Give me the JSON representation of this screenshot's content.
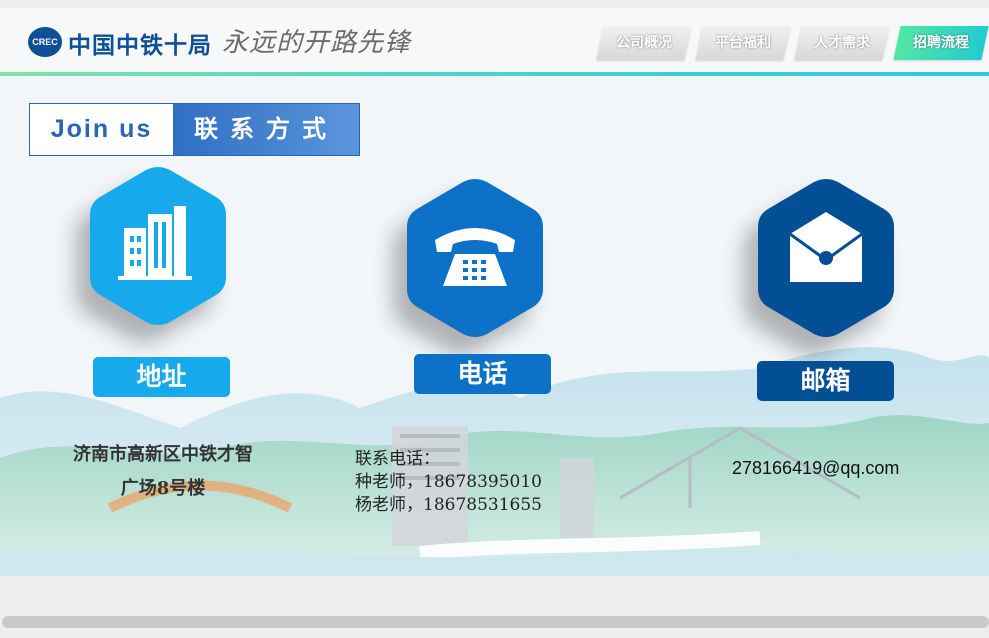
{
  "header": {
    "logo_text": "中国中铁十局",
    "logo_badge": "CREC",
    "slogan": "永远的开路先锋",
    "nav": [
      {
        "label": "公司概况",
        "active": false
      },
      {
        "label": "平台福利",
        "active": false
      },
      {
        "label": "人才需求",
        "active": false
      },
      {
        "label": "招聘流程",
        "active": true
      }
    ]
  },
  "section": {
    "title_en": "Join us",
    "title_zh": "联系方式"
  },
  "contacts": {
    "address": {
      "icon": "building-icon",
      "label": "地址",
      "lines": [
        "济南市高新区中铁才智",
        "广场8号楼"
      ],
      "color": "#16a9ec"
    },
    "phone": {
      "icon": "telephone-icon",
      "label": "电话",
      "lines": [
        "联系电话：",
        "种老师，18678395010",
        "杨老师，18678531655"
      ],
      "color": "#0d72c7"
    },
    "email": {
      "icon": "envelope-icon",
      "label": "邮箱",
      "value": "278166419@qq.com",
      "color": "#034f95"
    }
  },
  "colors": {
    "brand": "#0e4f98",
    "accent_gradient_start": "#53e6a3",
    "accent_gradient_end": "#23cbcf"
  }
}
